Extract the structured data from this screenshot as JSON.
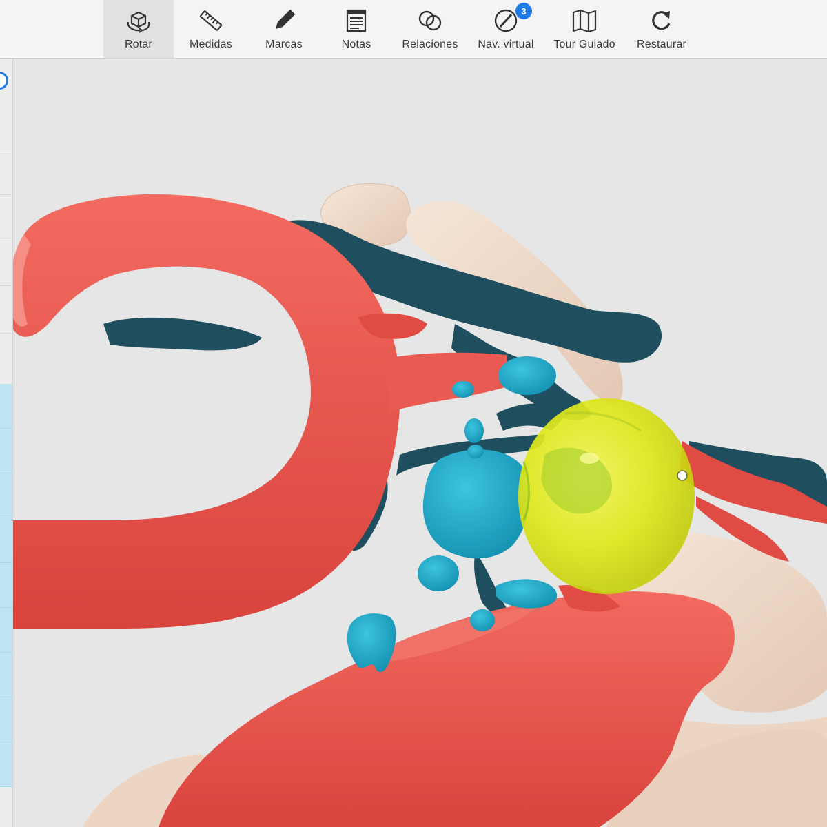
{
  "toolbar": {
    "items": [
      {
        "label": "Rotar",
        "icon": "rotate-3d-icon",
        "active": true
      },
      {
        "label": "Medidas",
        "icon": "ruler-icon"
      },
      {
        "label": "Marcas",
        "icon": "pencil-icon"
      },
      {
        "label": "Notas",
        "icon": "notes-icon"
      },
      {
        "label": "Relaciones",
        "icon": "relations-icon"
      },
      {
        "label": "Nav. virtual",
        "icon": "compass-icon",
        "badge": "3"
      },
      {
        "label": "Tour Guiado",
        "icon": "map-icon"
      },
      {
        "label": "Restaurar",
        "icon": "refresh-icon"
      }
    ]
  },
  "colors": {
    "artery": "#e8524a",
    "vein": "#1f4f5f",
    "cyst": "#1aa7c7",
    "tumor": "#e4ec1c",
    "bone": "#efd9c8",
    "background": "#e6e6e7",
    "accent": "#1f7ae6"
  }
}
